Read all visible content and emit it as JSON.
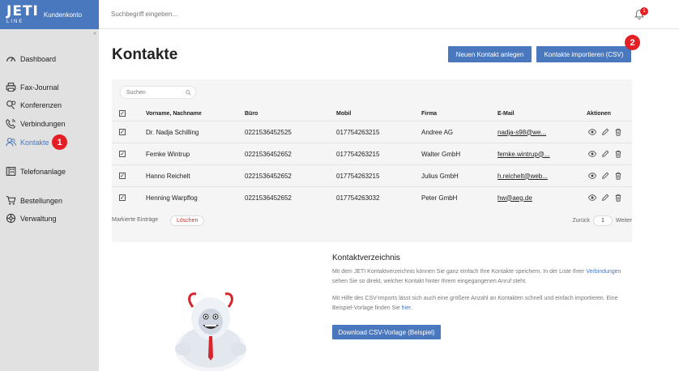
{
  "brand": {
    "logo_top": "JETI",
    "logo_bottom": "LINE",
    "subtitle": "Kundenkonto"
  },
  "topbar": {
    "search_placeholder": "Suchbegriff eingeben...",
    "notifications_count": "1"
  },
  "sidebar": {
    "items": [
      {
        "label": "Dashboard",
        "icon": "gauge-icon"
      },
      {
        "label": "Fax-Journal",
        "icon": "printer-icon"
      },
      {
        "label": "Konferenzen",
        "icon": "conference-icon"
      },
      {
        "label": "Verbindungen",
        "icon": "phone-icon"
      },
      {
        "label": "Kontakte",
        "icon": "contacts-icon",
        "active": true
      },
      {
        "label": "Telefonanlage",
        "icon": "switchboard-icon"
      },
      {
        "label": "Bestellungen",
        "icon": "cart-icon"
      },
      {
        "label": "Verwaltung",
        "icon": "gear-icon"
      }
    ],
    "annotation_1": "1"
  },
  "page": {
    "title": "Kontakte",
    "btn_new": "Neuen Kontakt anlegen",
    "btn_import": "Kontakte importieren (CSV)",
    "annotation_2": "2"
  },
  "table": {
    "search_placeholder": "Suchen",
    "headers": {
      "name": "Vorname, Nachname",
      "office": "Büro",
      "mobile": "Mobil",
      "company": "Firma",
      "email": "E-Mail",
      "actions": "Aktionen"
    },
    "rows": [
      {
        "name": "Dr. Nadja Schilling",
        "office": "0221536452525",
        "mobile": "017754263215",
        "company": "Andree AG",
        "email": "nadja-s98@we..."
      },
      {
        "name": "Femke Wintrup",
        "office": "0221536452652",
        "mobile": "017754263215",
        "company": "Walter GmbH",
        "email": "femke.wintrup@..."
      },
      {
        "name": "Hanno Reichelt",
        "office": "0221536452652",
        "mobile": "017754263215",
        "company": "Julius GmbH",
        "email": "h.reichelt@web..."
      },
      {
        "name": "Henning Warpflog",
        "office": "0221536452652",
        "mobile": "017754263032",
        "company": "Peter GmbH",
        "email": "hw@aeg.de"
      }
    ]
  },
  "footer": {
    "marked_label": "Markierte Einträge",
    "delete_label": "Löschen",
    "prev": "Zurück",
    "page": "1",
    "next": "Weiter"
  },
  "info": {
    "title": "Kontaktverzeichnis",
    "p1a": "Mit dem JETI Kontaktverzeichnis können Sie ganz einfach Ihre Kontakte speichern. In der Liste Ihrer",
    "p1_link": "Verbindungen",
    "p1b": " sehen Sie so direkt, welcher Kontakt hinter Ihrem eingegangenen Anruf steht.",
    "p2a": "Mit Hilfe des CSV-Imports lässt sich auch eine größere Anzahl an Kontakten schnell und einfach importieren.",
    "p2b": "Eine Beispiel-Vorlage finden Sie ",
    "p2_link": "hier",
    "p2c": ".",
    "download_label": "Download CSV-Vorlage (Beispiel)"
  },
  "colors": {
    "accent": "#4a78be",
    "badge": "#e31e24",
    "sidebar": "#e1e1e1"
  }
}
